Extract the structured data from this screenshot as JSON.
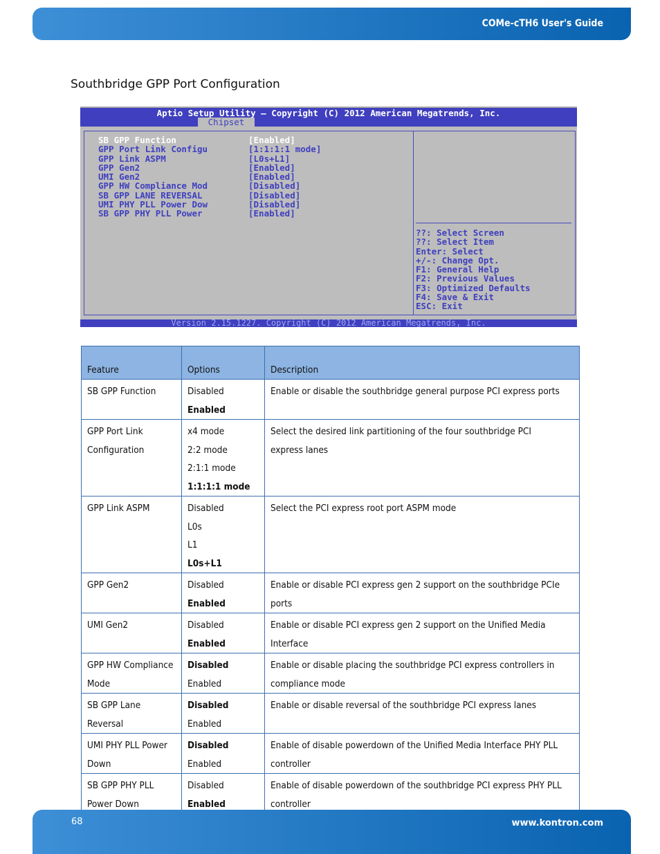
{
  "header": {
    "title": "COMe-cTH6 User's Guide"
  },
  "section_title": "Southbridge GPP Port Configuration",
  "bios": {
    "title": "Aptio Setup Utility – Copyright (C) 2012 American Megatrends, Inc.",
    "tab": "Chipset",
    "items": [
      {
        "label": "SB GPP Function",
        "value": "[Enabled]",
        "selected": true
      },
      {
        "label": "GPP Port Link Configu",
        "value": "[1:1:1:1 mode]"
      },
      {
        "label": "GPP Link ASPM",
        "value": "[L0s+L1]"
      },
      {
        "label": "GPP Gen2",
        "value": "[Enabled]"
      },
      {
        "label": "UMI Gen2",
        "value": "[Enabled]"
      },
      {
        "label": "GPP HW Compliance Mod",
        "value": "[Disabled]"
      },
      {
        "label": "SB GPP LANE REVERSAL",
        "value": "[Disabled]"
      },
      {
        "label": "UMI PHY PLL Power Dow",
        "value": "[Disabled]"
      },
      {
        "label": "SB GPP PHY PLL Power",
        "value": "[Enabled]"
      }
    ],
    "help": [
      "??: Select Screen",
      "??: Select Item",
      "Enter: Select",
      "+/-: Change Opt.",
      "F1: General Help",
      "F2: Previous Values",
      "F3: Optimized Defaults",
      "F4: Save & Exit",
      "ESC: Exit"
    ],
    "footer": "Version 2.15.1227. Copyright (C) 2012 American Megatrends, Inc.",
    "colors": {
      "bar": "#3f3fbf",
      "background": "#bdbdbd"
    }
  },
  "table": {
    "headers": [
      "Feature",
      "Options",
      "Description"
    ],
    "rows": [
      {
        "feature": [
          "SB GPP Function"
        ],
        "options": [
          "Disabled",
          "Enabled"
        ],
        "default": 1,
        "description": [
          "Enable or disable the southbridge general purpose PCI express ports"
        ]
      },
      {
        "feature": [
          "GPP Port Link",
          "Configuration"
        ],
        "options": [
          "x4 mode",
          "2:2 mode",
          "2:1:1 mode",
          "1:1:1:1 mode"
        ],
        "default": 3,
        "description": [
          "Select the desired link partitioning of the four southbridge PCI",
          "express lanes"
        ]
      },
      {
        "feature": [
          "GPP Link ASPM"
        ],
        "options": [
          "Disabled",
          "L0s",
          "L1",
          "L0s+L1"
        ],
        "default": 3,
        "description": [
          "Select the PCI express root port ASPM mode"
        ]
      },
      {
        "feature": [
          "GPP Gen2"
        ],
        "options": [
          "Disabled",
          "Enabled"
        ],
        "default": 1,
        "description": [
          "Enable or disable PCI express gen 2 support on the southbridge PCIe",
          "ports"
        ]
      },
      {
        "feature": [
          "UMI Gen2"
        ],
        "options": [
          "Disabled",
          "Enabled"
        ],
        "default": 1,
        "description": [
          "Enable or disable PCI express gen 2 support on the Unified Media",
          "Interface"
        ]
      },
      {
        "feature": [
          "GPP HW Compliance",
          "Mode"
        ],
        "options": [
          "Disabled",
          "Enabled"
        ],
        "default": 0,
        "description": [
          "Enable or disable placing the southbridge PCI express controllers in",
          "compliance mode"
        ]
      },
      {
        "feature": [
          "SB GPP Lane",
          "Reversal"
        ],
        "options": [
          "Disabled",
          "Enabled"
        ],
        "default": 0,
        "description": [
          "Enable or disable reversal of the southbridge PCI express lanes"
        ]
      },
      {
        "feature": [
          "UMI PHY PLL Power",
          "Down"
        ],
        "options": [
          "Disabled",
          "Enabled"
        ],
        "default": 0,
        "description": [
          "Enable of disable powerdown of the Unified Media Interface PHY PLL",
          "controller"
        ]
      },
      {
        "feature": [
          "SB GPP PHY PLL",
          "Power Down"
        ],
        "options": [
          "Disabled",
          "Enabled"
        ],
        "default": 1,
        "description": [
          "Enable of disable powerdown of the southbridge PCI express PHY PLL",
          "controller"
        ]
      }
    ]
  },
  "footer": {
    "page": "68",
    "url": "www.kontron.com"
  }
}
